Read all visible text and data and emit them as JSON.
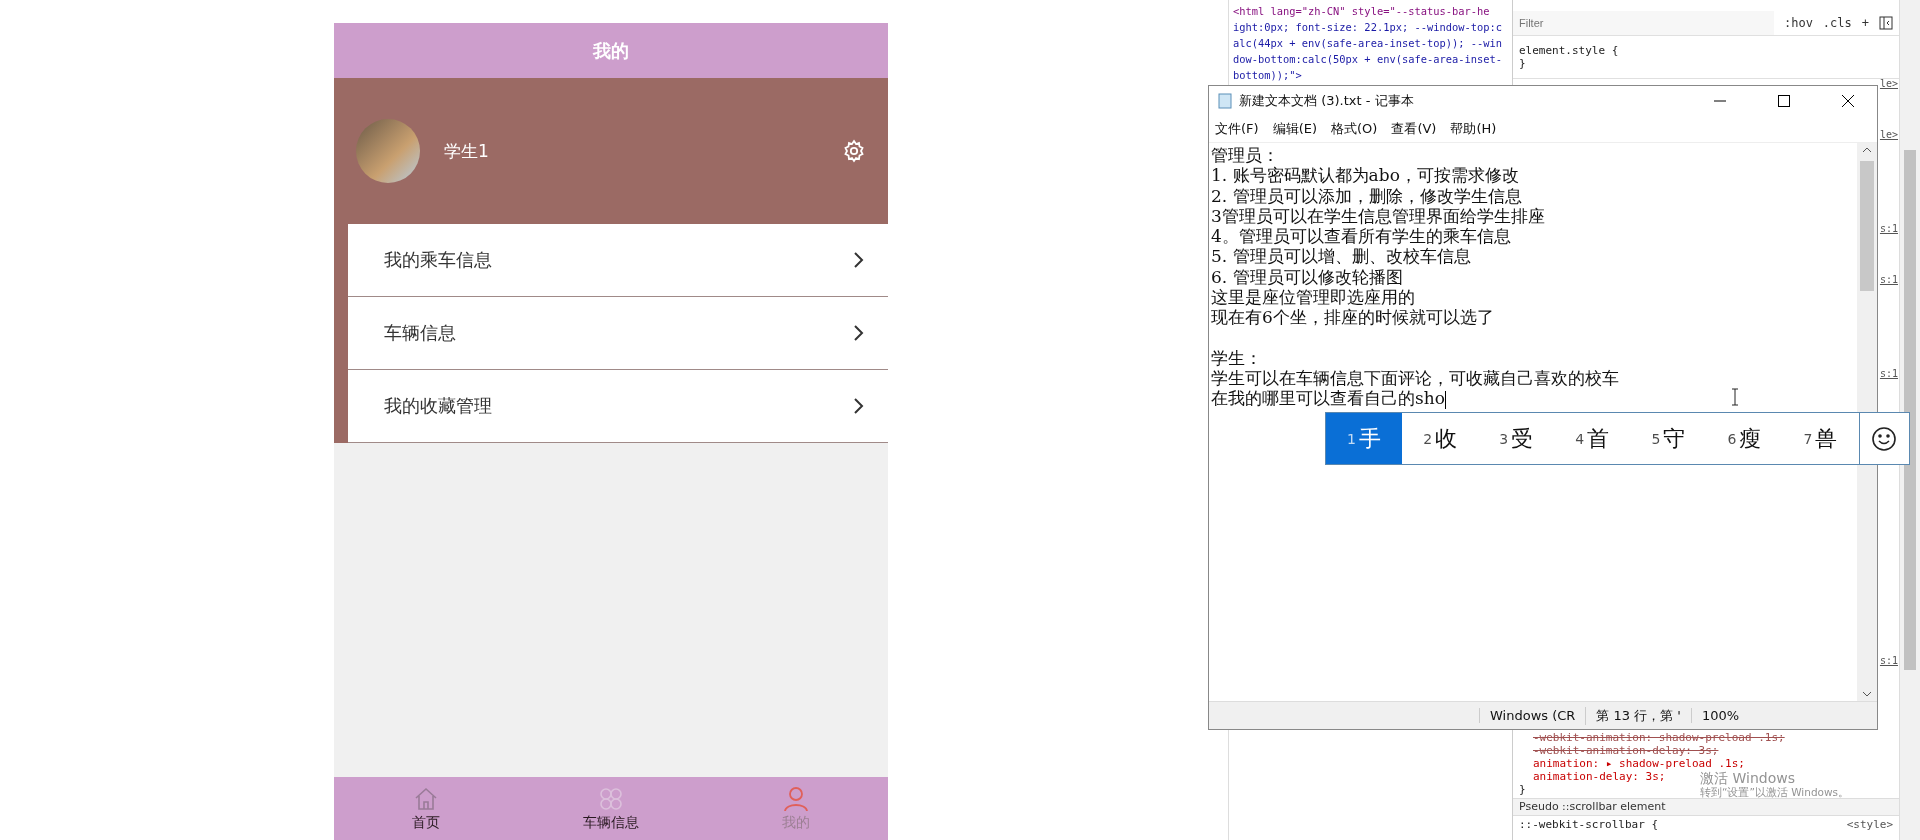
{
  "phone": {
    "title": "我的",
    "profile": {
      "name": "学生1"
    },
    "menu": [
      {
        "label": "我的乘车信息"
      },
      {
        "label": "车辆信息"
      },
      {
        "label": "我的收藏管理"
      }
    ],
    "tabbar": [
      {
        "label": "首页",
        "kind": "home",
        "selected": false
      },
      {
        "label": "车辆信息",
        "kind": "grid",
        "selected": false
      },
      {
        "label": "我的",
        "kind": "person",
        "selected": true
      }
    ]
  },
  "devtools": {
    "element_lines": [
      "<html lang=\"zh-CN\" style=\"--status-bar-he",
      "ight:0px; font-size: 22.1px; --window-top:c",
      "alc(44px + env(safe-area-inset-top)); --win",
      "dow-bottom:calc(50px + env(safe-area-inset-",
      "bottom));\">"
    ],
    "filter_placeholder": "Filter",
    "tools": [
      ":hov",
      ".cls",
      "+"
    ],
    "rule_lines": [
      "element.style {",
      "}"
    ],
    "side_marks": [
      "le>",
      "le>",
      "s:1",
      "s:1",
      "s:1",
      "s:1"
    ],
    "lower_lines": [
      {
        "text": "-webkit-animation: shadow-preload .1s;",
        "kind": "struck"
      },
      {
        "text": "-webkit-animation-delay: 3s;",
        "kind": "struck"
      },
      {
        "text": "animation: ▸ shadow-preload .1s;",
        "kind": "active"
      },
      {
        "text": "animation-delay: 3s;",
        "kind": "active"
      },
      {
        "text": "}",
        "kind": "brace"
      }
    ],
    "pseudo_header": "Pseudo ::scrollbar element",
    "last_selector": "::-webkit-scrollbar {",
    "last_source": "<style>"
  },
  "notepad": {
    "title": "新建文本文档 (3).txt - 记事本",
    "menu": [
      "文件(F)",
      "编辑(E)",
      "格式(O)",
      "查看(V)",
      "帮助(H)"
    ],
    "sections": [
      {
        "lines": [
          "管理员：",
          "1. 账号密码默认都为abo，可按需求修改",
          "2. 管理员可以添加，删除，修改学生信息",
          "3管理员可以在学生信息管理界面给学生排座",
          "4。管理员可以查看所有学生的乘车信息",
          "5. 管理员可以增、删、改校车信息",
          "6. 管理员可以修改轮播图",
          "这里是座位管理即选座用的",
          "现在有6个坐，排座的时候就可以选了"
        ]
      },
      {
        "lines": [
          "学生：",
          "学生可以在车辆信息下面评论，可收藏自己喜欢的校车",
          "在我的哪里可以查看自己的sho"
        ]
      }
    ],
    "status": [
      "Windows (CR",
      "第 13 行，第 '",
      "100%"
    ]
  },
  "ime": {
    "candidates": [
      {
        "number": "1",
        "char": "手",
        "selected": true
      },
      {
        "number": "2",
        "char": "收",
        "selected": false
      },
      {
        "number": "3",
        "char": "受",
        "selected": false
      },
      {
        "number": "4",
        "char": "首",
        "selected": false
      },
      {
        "number": "5",
        "char": "守",
        "selected": false
      },
      {
        "number": "6",
        "char": "瘦",
        "selected": false
      },
      {
        "number": "7",
        "char": "兽",
        "selected": false
      }
    ]
  },
  "os_notice": {
    "title": "激活 Windows",
    "subtitle": "转到“设置”以激活 Windows。"
  }
}
